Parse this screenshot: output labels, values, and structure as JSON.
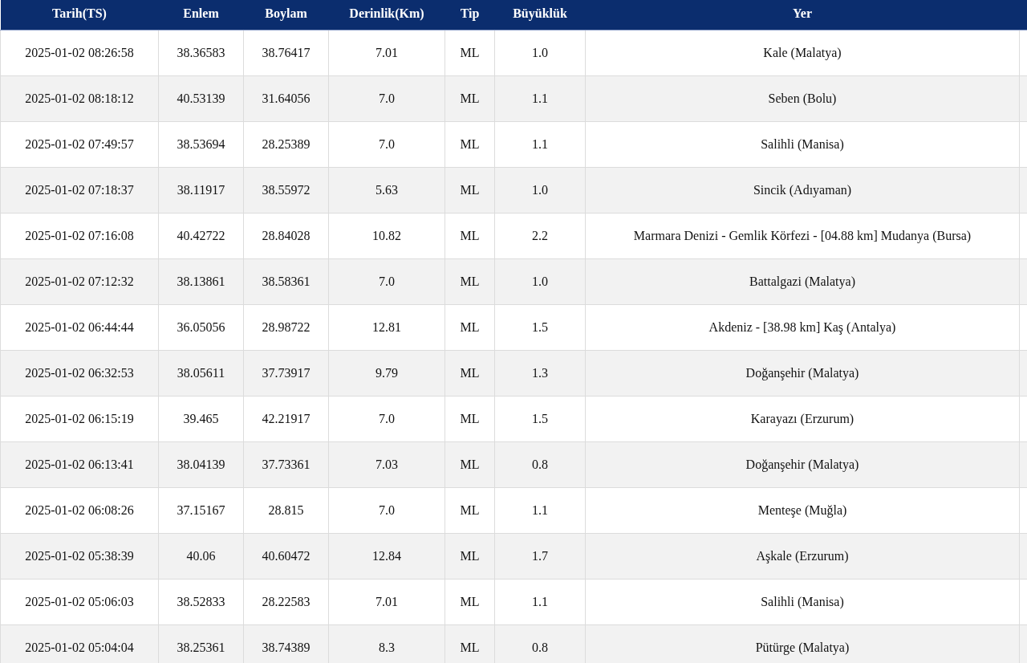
{
  "table": {
    "columns": [
      "Tarih(TS)",
      "Enlem",
      "Boylam",
      "Derinlik(Km)",
      "Tip",
      "Büyüklük",
      "Yer"
    ],
    "rows": [
      [
        "2025-01-02 08:26:58",
        "38.36583",
        "38.76417",
        "7.01",
        "ML",
        "1.0",
        "Kale (Malatya)"
      ],
      [
        "2025-01-02 08:18:12",
        "40.53139",
        "31.64056",
        "7.0",
        "ML",
        "1.1",
        "Seben (Bolu)"
      ],
      [
        "2025-01-02 07:49:57",
        "38.53694",
        "28.25389",
        "7.0",
        "ML",
        "1.1",
        "Salihli (Manisa)"
      ],
      [
        "2025-01-02 07:18:37",
        "38.11917",
        "38.55972",
        "5.63",
        "ML",
        "1.0",
        "Sincik (Adıyaman)"
      ],
      [
        "2025-01-02 07:16:08",
        "40.42722",
        "28.84028",
        "10.82",
        "ML",
        "2.2",
        "Marmara Denizi - Gemlik Körfezi - [04.88 km] Mudanya (Bursa)"
      ],
      [
        "2025-01-02 07:12:32",
        "38.13861",
        "38.58361",
        "7.0",
        "ML",
        "1.0",
        "Battalgazi (Malatya)"
      ],
      [
        "2025-01-02 06:44:44",
        "36.05056",
        "28.98722",
        "12.81",
        "ML",
        "1.5",
        "Akdeniz - [38.98 km] Kaş (Antalya)"
      ],
      [
        "2025-01-02 06:32:53",
        "38.05611",
        "37.73917",
        "9.79",
        "ML",
        "1.3",
        "Doğanşehir (Malatya)"
      ],
      [
        "2025-01-02 06:15:19",
        "39.465",
        "42.21917",
        "7.0",
        "ML",
        "1.5",
        "Karayazı (Erzurum)"
      ],
      [
        "2025-01-02 06:13:41",
        "38.04139",
        "37.73361",
        "7.03",
        "ML",
        "0.8",
        "Doğanşehir (Malatya)"
      ],
      [
        "2025-01-02 06:08:26",
        "37.15167",
        "28.815",
        "7.0",
        "ML",
        "1.1",
        "Menteşe (Muğla)"
      ],
      [
        "2025-01-02 05:38:39",
        "40.06",
        "40.60472",
        "12.84",
        "ML",
        "1.7",
        "Aşkale (Erzurum)"
      ],
      [
        "2025-01-02 05:06:03",
        "38.52833",
        "28.22583",
        "7.01",
        "ML",
        "1.1",
        "Salihli (Manisa)"
      ],
      [
        "2025-01-02 05:04:04",
        "38.25361",
        "38.74389",
        "8.3",
        "ML",
        "0.8",
        "Pütürge (Malatya)"
      ]
    ]
  }
}
